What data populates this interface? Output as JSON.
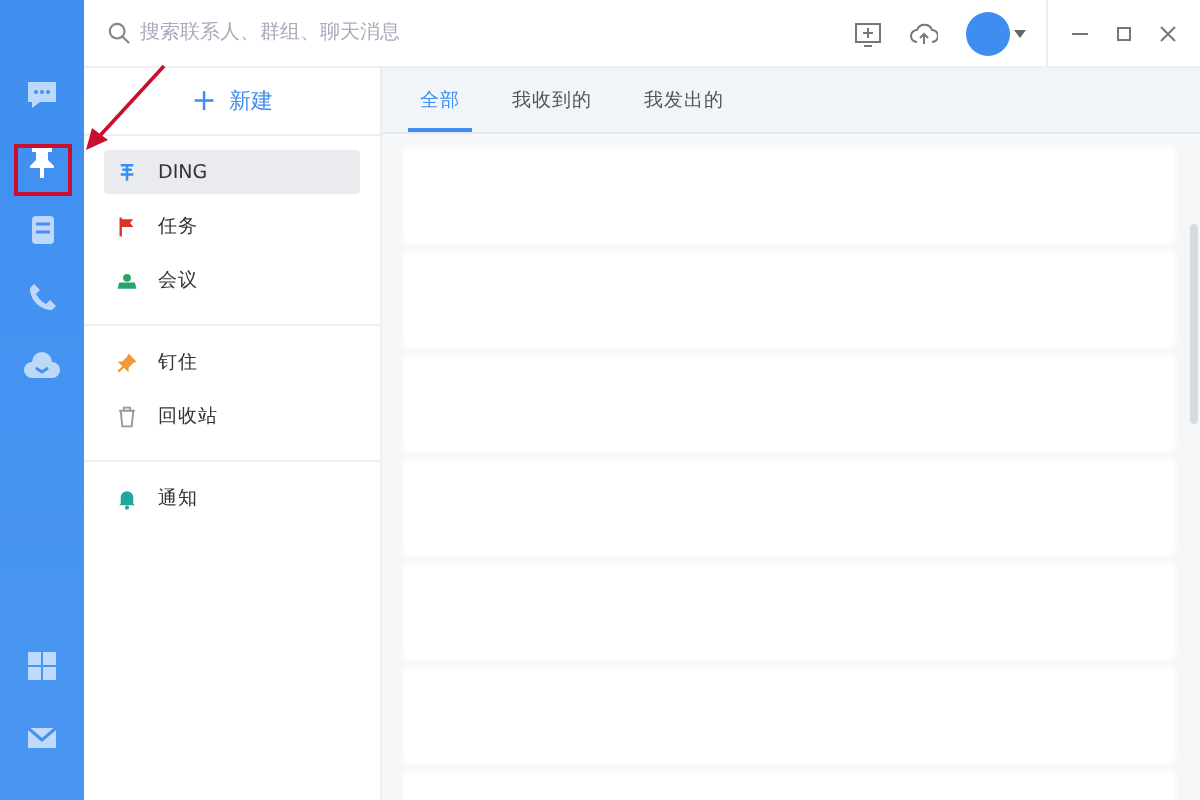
{
  "rail": {
    "top_items": [
      {
        "kind": "chat",
        "selected": false
      },
      {
        "kind": "pin",
        "selected": true
      },
      {
        "kind": "book",
        "selected": false
      },
      {
        "kind": "phone",
        "selected": false
      },
      {
        "kind": "cloud",
        "selected": false
      }
    ],
    "bottom_items": [
      {
        "kind": "grid",
        "selected": false
      },
      {
        "kind": "mail",
        "selected": false
      }
    ]
  },
  "search": {
    "placeholder": "搜索联系人、群组、聊天消息"
  },
  "new_button": {
    "icon": "+",
    "label": "新建"
  },
  "menu_groups": [
    [
      {
        "kind": "ding",
        "label": "DING",
        "selected": true
      },
      {
        "kind": "task",
        "label": "任务",
        "selected": false
      },
      {
        "kind": "meeting",
        "label": "会议",
        "selected": false
      }
    ],
    [
      {
        "kind": "pinned",
        "label": "钉住",
        "selected": false
      },
      {
        "kind": "trash",
        "label": "回收站",
        "selected": false
      }
    ],
    [
      {
        "kind": "notice",
        "label": "通知",
        "selected": false
      }
    ]
  ],
  "tabs": [
    {
      "label": "全部",
      "selected": true
    },
    {
      "label": "我收到的",
      "selected": false
    },
    {
      "label": "我发出的",
      "selected": false
    }
  ],
  "annotation": {
    "highlight_box": true,
    "arrow": true
  }
}
